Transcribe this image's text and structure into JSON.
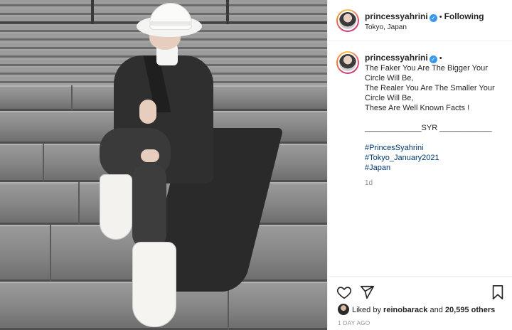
{
  "header": {
    "username": "princessyahrini",
    "follow_label": "Following",
    "separator": "•",
    "location": "Tokyo, Japan"
  },
  "caption": {
    "username": "princessyahrini",
    "separator": "•",
    "lines": [
      "The Faker You Are The Bigger Your",
      "Circle Will Be,",
      "The Realer You Are The Smaller Your",
      "Circle Will Be,",
      "These Are Well Known Facts !"
    ],
    "signature": "_____________SYR ____________",
    "hashtags": [
      "#PrincesSyahrini",
      "#Tokyo_January2021",
      "#Japan"
    ],
    "age": "1d"
  },
  "likes": {
    "prefix": "Liked by",
    "user": "reinobarack",
    "joiner": "and",
    "others": "20,595 others"
  },
  "time_ago": "1 DAY AGO",
  "icons": {
    "like": "heart-icon",
    "share": "send-icon",
    "save": "bookmark-icon",
    "verified": "verified-badge-icon"
  },
  "colors": {
    "verified": "#3897f0",
    "hashtag": "#00376b",
    "muted": "#8e8e8e"
  }
}
